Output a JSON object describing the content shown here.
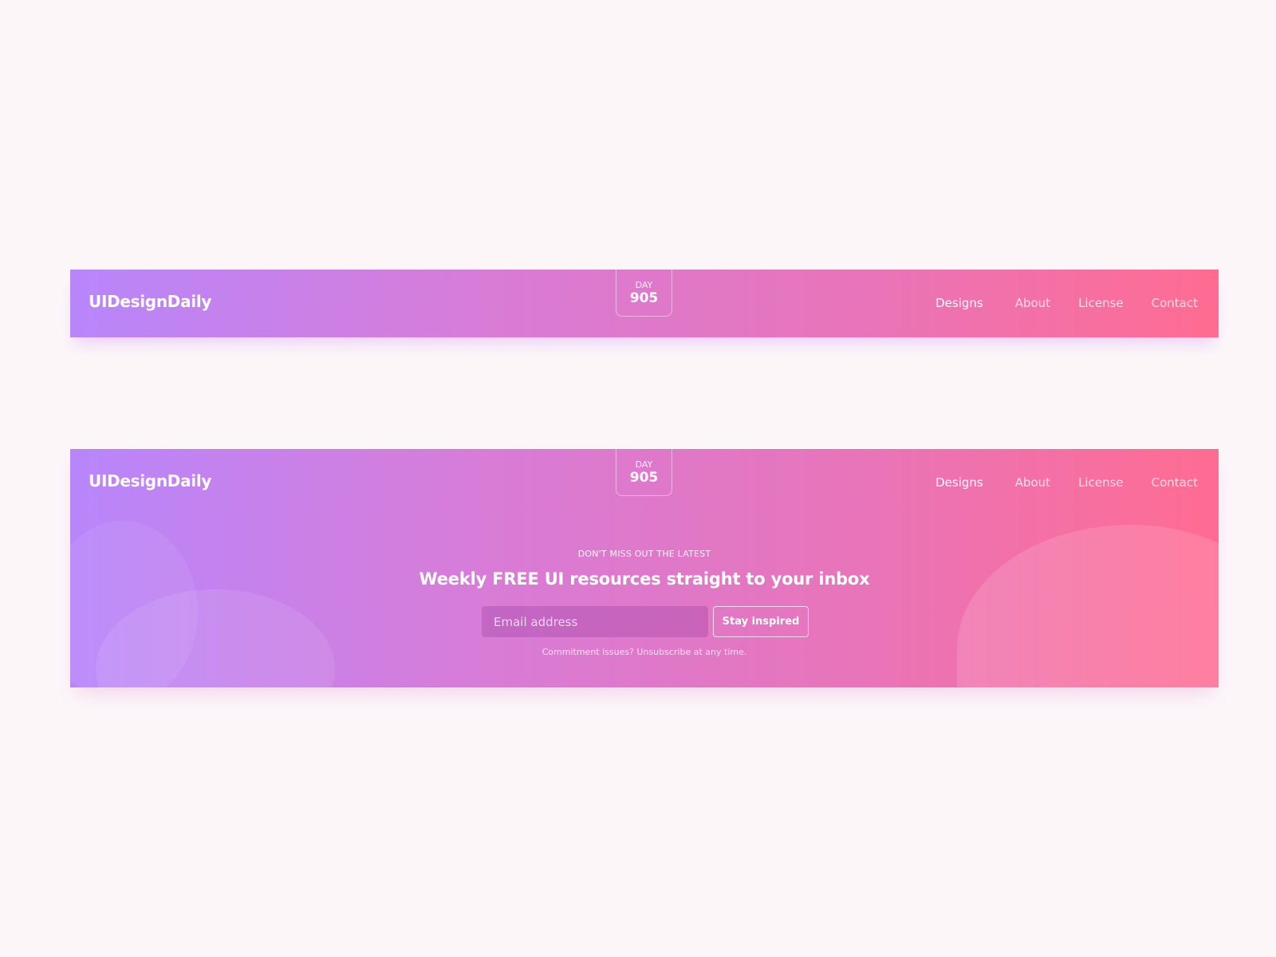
{
  "header": {
    "logo": "UIDesignDaily",
    "day_label": "DAY",
    "day_number": "905",
    "nav": [
      {
        "label": "Designs"
      },
      {
        "label": "About"
      },
      {
        "label": "License"
      },
      {
        "label": "Contact"
      }
    ]
  },
  "newsletter": {
    "eyebrow": "DON'T MISS OUT THE LATEST",
    "headline": "Weekly FREE UI resources straight to your inbox",
    "email_placeholder": "Email address",
    "button_label": "Stay inspired",
    "note": "Commitment issues? Unsubscribe at any time."
  },
  "colors": {
    "gradient_start": "#b886fb",
    "gradient_end": "#ff6c92",
    "page_background": "#fcf6f9"
  }
}
